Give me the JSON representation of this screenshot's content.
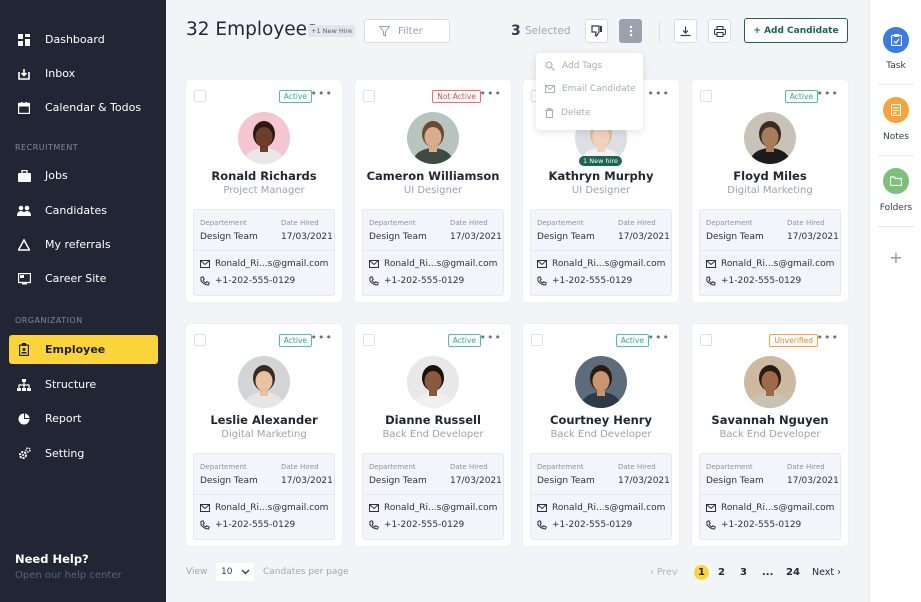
{
  "sidebar": {
    "items": [
      {
        "label": "Dashboard",
        "icon": "dashboard-icon"
      },
      {
        "label": "Inbox",
        "icon": "inbox-icon"
      },
      {
        "label": "Calendar & Todos",
        "icon": "calendar-icon"
      }
    ],
    "section_recruitment": "RECRUITMENT",
    "recruitment_items": [
      {
        "label": "Jobs",
        "icon": "briefcase-icon"
      },
      {
        "label": "Candidates",
        "icon": "people-icon"
      },
      {
        "label": "My referrals",
        "icon": "triangle-icon"
      },
      {
        "label": "Career Site",
        "icon": "career-site-icon"
      }
    ],
    "section_organization": "ORGANIZATION",
    "organization_items": [
      {
        "label": "Employee",
        "icon": "employee-icon",
        "active": true
      },
      {
        "label": "Structure",
        "icon": "structure-icon"
      },
      {
        "label": "Report",
        "icon": "pie-chart-icon"
      },
      {
        "label": "Setting",
        "icon": "gear-icon"
      }
    ],
    "help_title": "Need Help?",
    "help_sub": "Open our help center"
  },
  "header": {
    "title": "32 Employees",
    "new_hire_badge": "+1 New Hire",
    "filter_label": "Filter",
    "selected_count": "3",
    "selected_label": "Selected",
    "add_candidate": "+ Add Candidate"
  },
  "dropdown": {
    "items": [
      {
        "label": "Add Tags",
        "icon": "tag-search-icon"
      },
      {
        "label": "Email Candidate",
        "icon": "mail-icon"
      },
      {
        "label": "Delete",
        "icon": "trash-icon"
      }
    ]
  },
  "labels": {
    "department": "Departement",
    "date_hired": "Date Hired"
  },
  "employees": [
    {
      "name": "Ronald Richards",
      "role": "Project Manager",
      "status": "Active",
      "department": "Design Team",
      "date": "17/03/2021",
      "email": "Ronald_Ri...s@gmail.com",
      "phone": "+1-202-555-0129"
    },
    {
      "name": "Cameron Williamson",
      "role": "UI Designer",
      "status": "Not Active",
      "department": "Design Team",
      "date": "17/03/2021",
      "email": "Ronald_Ri...s@gmail.com",
      "phone": "+1-202-555-0129"
    },
    {
      "name": "Kathryn Murphy",
      "role": "UI Designer",
      "status": "",
      "hire_chip": "1 New hire",
      "department": "Design Team",
      "date": "17/03/2021",
      "email": "Ronald_Ri...s@gmail.com",
      "phone": "+1-202-555-0129"
    },
    {
      "name": "Floyd Miles",
      "role": "Digital Marketing",
      "status": "Active",
      "department": "Design Team",
      "date": "17/03/2021",
      "email": "Ronald_Ri...s@gmail.com",
      "phone": "+1-202-555-0129"
    },
    {
      "name": "Leslie Alexander",
      "role": "Digital Marketing",
      "status": "Active",
      "department": "Design Team",
      "date": "17/03/2021",
      "email": "Ronald_Ri...s@gmail.com",
      "phone": "+1-202-555-0129"
    },
    {
      "name": "Dianne Russell",
      "role": "Back End Developer",
      "status": "Active",
      "department": "Design Team",
      "date": "17/03/2021",
      "email": "Ronald_Ri...s@gmail.com",
      "phone": "+1-202-555-0129"
    },
    {
      "name": "Courtney Henry",
      "role": "Back End Developer",
      "status": "Active",
      "department": "Design Team",
      "date": "17/03/2021",
      "email": "Ronald_Ri...s@gmail.com",
      "phone": "+1-202-555-0129"
    },
    {
      "name": "Savannah Nguyen",
      "role": "Back End Developer",
      "status": "Unverified",
      "department": "Design Team",
      "date": "17/03/2021",
      "email": "Ronald_Ri...s@gmail.com",
      "phone": "+1-202-555-0129"
    }
  ],
  "footer": {
    "view_label": "View",
    "per_page_value": "10",
    "per_page_label": "Candates per page",
    "prev": "Prev",
    "pages": [
      "1",
      "2",
      "3",
      "...",
      "24"
    ],
    "next": "Next"
  },
  "rightbar": {
    "items": [
      {
        "label": "Task",
        "icon": "task-icon",
        "color": "#3b7be0"
      },
      {
        "label": "Notes",
        "icon": "notes-icon",
        "color": "#f3a43e"
      },
      {
        "label": "Folders",
        "icon": "folder-icon",
        "color": "#7cc07a"
      }
    ],
    "add_icon": "plus-icon"
  },
  "colors": {
    "sidebar_bg": "#222634",
    "accent": "#fbd43b",
    "brand_green": "#1e6453"
  }
}
